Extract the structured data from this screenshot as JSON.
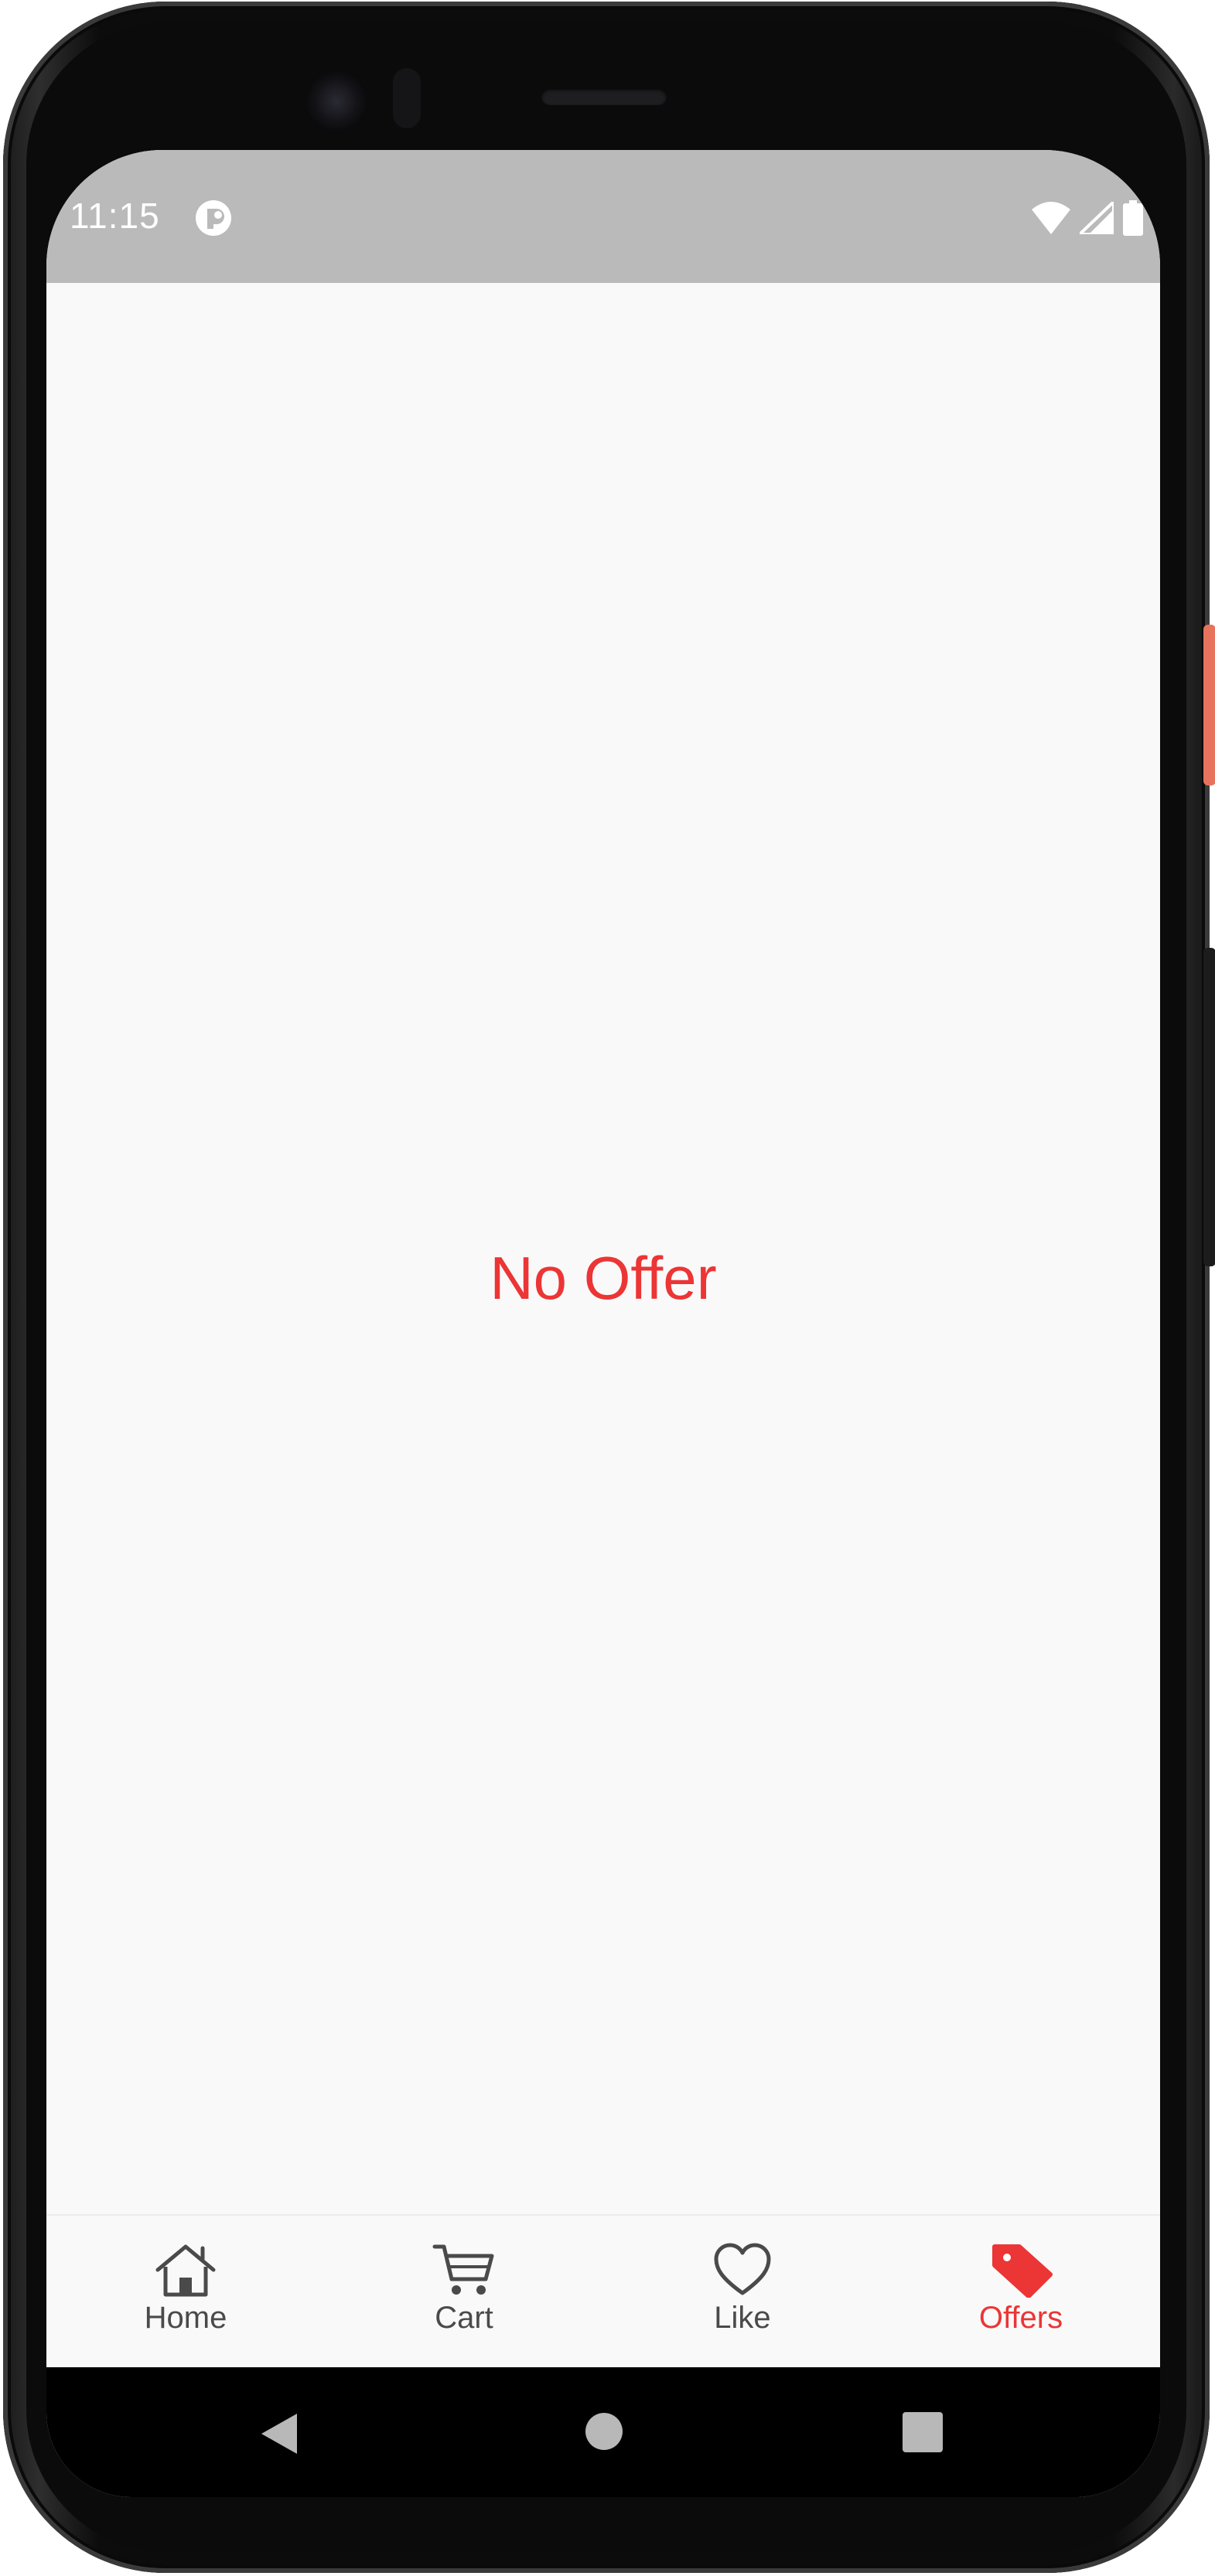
{
  "status_bar": {
    "time": "11:15",
    "app_icon": "notification-app-icon",
    "icons": [
      "wifi-icon",
      "cell-signal-icon",
      "battery-icon"
    ]
  },
  "main": {
    "empty_message": "No Offer"
  },
  "bottom_nav": {
    "items": [
      {
        "label": "Home",
        "icon": "home-icon",
        "active": false
      },
      {
        "label": "Cart",
        "icon": "cart-icon",
        "active": false
      },
      {
        "label": "Like",
        "icon": "heart-icon",
        "active": false
      },
      {
        "label": "Offers",
        "icon": "tag-icon",
        "active": true
      }
    ]
  },
  "system_nav": {
    "buttons": [
      "back-icon",
      "home-circle-icon",
      "recents-icon"
    ]
  },
  "colors": {
    "accent": "#ec3535",
    "status_bar": "#bababa",
    "background": "#f9f9f9",
    "inactive_nav": "#4a4a4a"
  }
}
